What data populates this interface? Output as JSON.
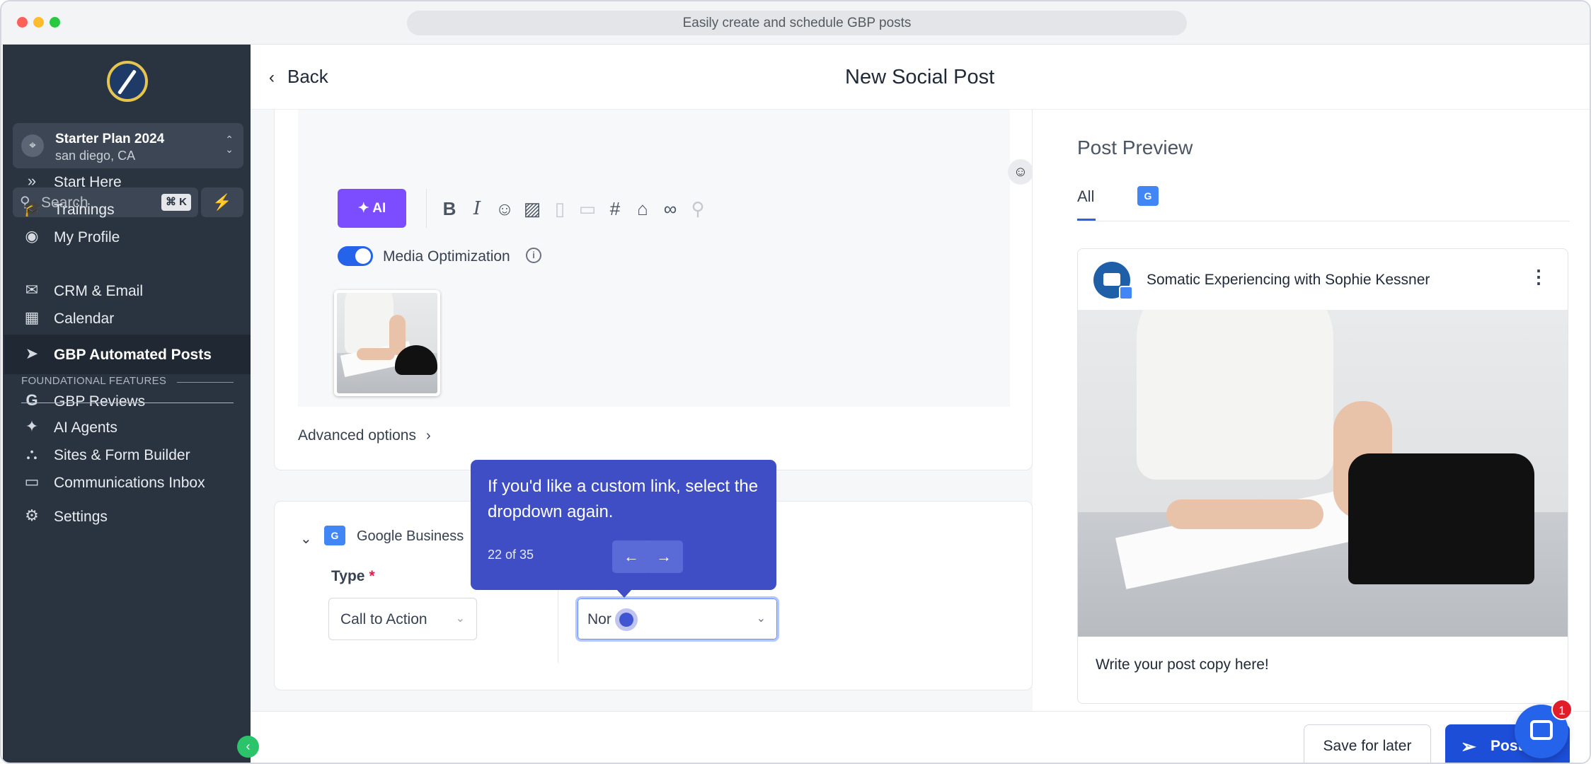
{
  "window": {
    "url_title": "Easily create and schedule GBP posts"
  },
  "sidebar": {
    "account": {
      "name": "Starter Plan 2024",
      "location": "san diego, CA"
    },
    "search": {
      "placeholder": "Search",
      "shortcut": "⌘ K"
    },
    "items_top": [
      {
        "label": "Start Here",
        "icon": "chevrons-right-icon"
      },
      {
        "label": "Trainings",
        "icon": "graduation-cap-icon"
      },
      {
        "label": "My Profile",
        "icon": "user-circle-icon"
      }
    ],
    "section_label": "FOUNDATIONAL FEATURES",
    "items_foundational": [
      {
        "label": "CRM & Email",
        "icon": "mail-open-icon"
      },
      {
        "label": "Calendar",
        "icon": "calendar-icon"
      },
      {
        "label": "GBP Automated Posts",
        "icon": "send-arrow-icon",
        "active": true
      },
      {
        "label": "GBP Reviews",
        "icon": "google-g-icon"
      }
    ],
    "items_bottom": [
      {
        "label": "AI Agents",
        "icon": "sparkle-icon"
      },
      {
        "label": "Sites & Form Builder",
        "icon": "sitemap-icon"
      },
      {
        "label": "Communications Inbox",
        "icon": "inbox-icon"
      }
    ],
    "settings_label": "Settings"
  },
  "header": {
    "back_label": "Back",
    "title": "New Social Post"
  },
  "editor": {
    "ai_label": "AI",
    "media_optimization_label": "Media Optimization",
    "advanced_options_label": "Advanced options"
  },
  "google_business": {
    "name": "Google Business",
    "type_label": "Type",
    "type_value": "Call to Action",
    "cta_value": "Nor"
  },
  "tooltip": {
    "text": "If you'd like a custom link, select the dropdown again.",
    "counter": "22 of 35"
  },
  "preview": {
    "title": "Post Preview",
    "tab_all": "All",
    "business_name": "Somatic Experiencing with Sophie Kessner",
    "post_copy": "Write your post copy here!"
  },
  "actions": {
    "save_label": "Save for later",
    "post_label": "Post"
  },
  "chat": {
    "badge_count": "1"
  },
  "colors": {
    "sidebar_bg": "#2a3441",
    "accent": "#1d4ed8",
    "tooltip_bg": "#3f4ec4",
    "ai_purple": "#7c4dff"
  }
}
